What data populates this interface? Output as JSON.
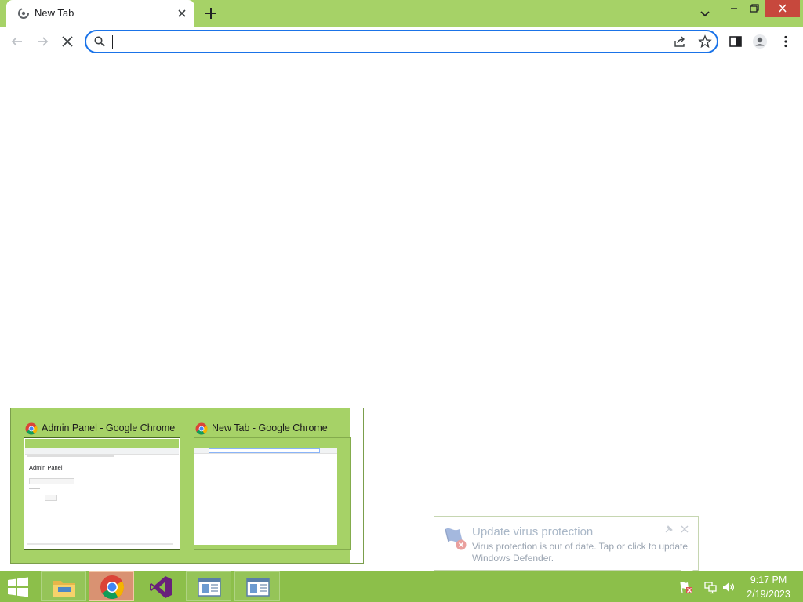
{
  "colors": {
    "chrome_frame": "#a6d267",
    "taskbar": "#8cbf4a",
    "omnibox_focus": "#1a73e8",
    "close_button": "#c7483d"
  },
  "browser": {
    "tab": {
      "title": "New Tab",
      "favicon": "loading-favicon-icon"
    },
    "omnibox": {
      "value": "",
      "placeholder": ""
    },
    "icons": [
      "back-icon",
      "forward-icon",
      "stop-loading-icon",
      "search-icon",
      "share-icon",
      "bookmark-star-icon",
      "side-panel-icon",
      "profile-icon",
      "menu-icon",
      "tab-search-icon"
    ]
  },
  "thumbnails": [
    {
      "title": "Admin Panel - Google Chrome",
      "preview_heading": "Admin Panel"
    },
    {
      "title": "New Tab - Google Chrome"
    }
  ],
  "notification": {
    "title": "Update virus protection",
    "body": "Virus protection is out of date. Tap or click to update Windows Defender."
  },
  "taskbar": {
    "apps": [
      "file-explorer-icon",
      "chrome-icon",
      "visual-studio-icon",
      "document-icon",
      "document-icon"
    ],
    "tray": [
      "defender-warning-icon",
      "network-icon",
      "volume-icon"
    ],
    "time": "9:17 PM",
    "date": "2/19/2023"
  }
}
